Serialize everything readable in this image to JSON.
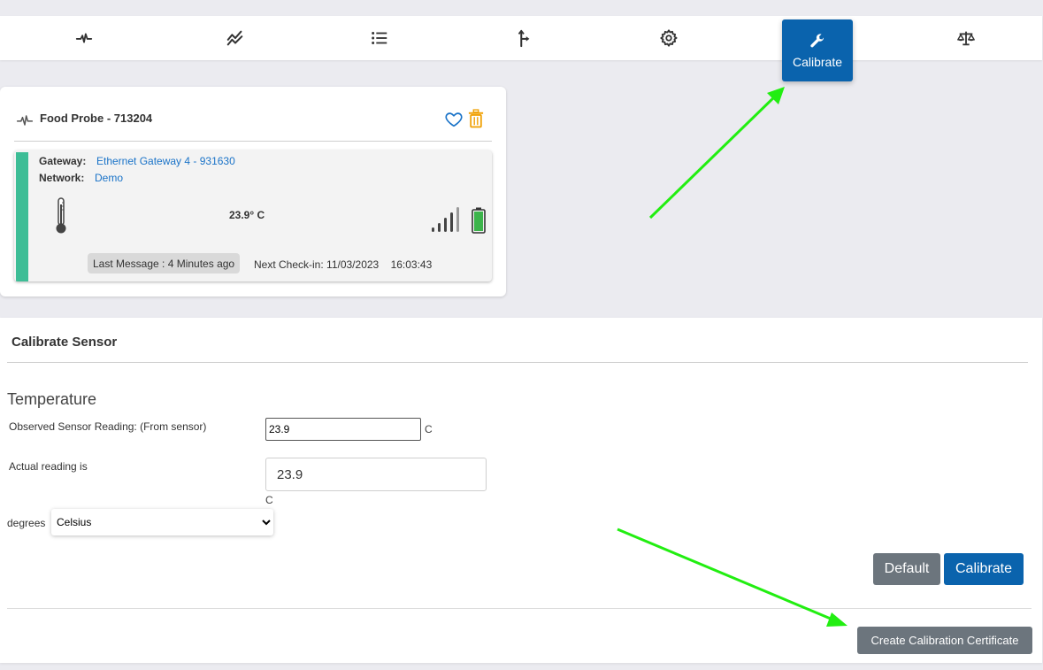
{
  "nav": {
    "items": [
      {
        "name": "activity",
        "icon": "activity-pulse-icon"
      },
      {
        "name": "trends",
        "icon": "chart-line-icon"
      },
      {
        "name": "list",
        "icon": "list-icon"
      },
      {
        "name": "routing",
        "icon": "split-arrow-icon"
      },
      {
        "name": "settings",
        "icon": "gear-icon"
      },
      {
        "name": "calibrate",
        "icon": "wrench-icon",
        "label": "Calibrate",
        "active": true
      },
      {
        "name": "compare",
        "icon": "balance-scale-icon"
      }
    ],
    "active_color": "#0a63ad"
  },
  "sensor_card": {
    "title": "Food Probe - 713204",
    "icons": [
      "activity-pulse-icon",
      "heart-icon",
      "trash-icon",
      "thermometer-icon",
      "signal-bars-icon",
      "battery-icon"
    ],
    "gateway_label": "Gateway:",
    "gateway_value": "Ethernet Gateway 4 - 931630",
    "network_label": "Network:",
    "network_value": "Demo",
    "reading": "23.9° C",
    "last_message": "Last Message : 4 Minutes ago",
    "next_checkin_label": "Next Check-in:",
    "next_checkin_date": "11/03/2023",
    "next_checkin_time": "16:03:43",
    "status_color": "#3dbd96",
    "battery_color": "#3cb44b"
  },
  "calibrate": {
    "title": "Calibrate Sensor",
    "section": "Temperature",
    "observed_label": "Observed Sensor Reading: (From sensor)",
    "observed_value": "23.9",
    "observed_unit": "C",
    "actual_label": "Actual reading is",
    "actual_value": "23.9",
    "actual_unit": "C",
    "degrees_label": "degrees",
    "degrees_selected": "Celsius",
    "default_button": "Default",
    "calibrate_button": "Calibrate",
    "certificate_button": "Create Calibration Certificate"
  },
  "annotation_color": "#22ee11"
}
